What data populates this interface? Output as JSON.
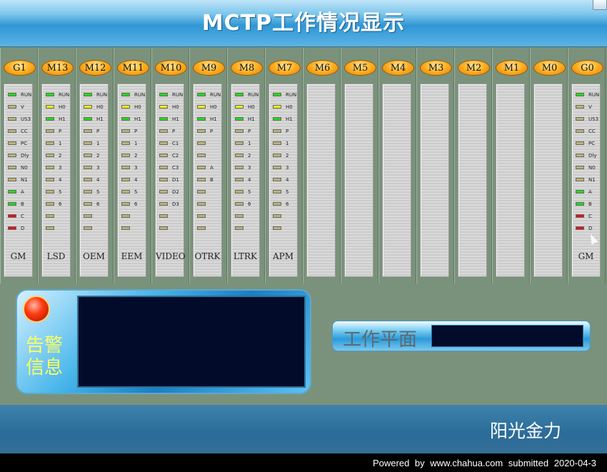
{
  "app": {
    "title": "MCTP工作情况显示"
  },
  "colors": {
    "led_green": "#22d82a",
    "led_yellow": "#f2ef1e",
    "led_red": "#e0102e",
    "led_off": "#b7b28a",
    "title_blue": "#2f96d4",
    "strip_bg": "#7a927b"
  },
  "modules": [
    {
      "id": "G1",
      "name": "GM",
      "leds": [
        {
          "s": "green",
          "t": "RUN"
        },
        {
          "s": "off",
          "t": "V"
        },
        {
          "s": "off",
          "t": "US3"
        },
        {
          "s": "off",
          "t": "CC"
        },
        {
          "s": "off",
          "t": "PC"
        },
        {
          "s": "off",
          "t": "Dly"
        },
        {
          "s": "off",
          "t": "N0"
        },
        {
          "s": "off",
          "t": "N1"
        },
        {
          "s": "green",
          "t": "A"
        },
        {
          "s": "green",
          "t": "B"
        },
        {
          "s": "red",
          "t": "C"
        },
        {
          "s": "red",
          "t": "D"
        }
      ]
    },
    {
      "id": "M13",
      "name": "LSD",
      "leds": [
        {
          "s": "green",
          "t": "RUN"
        },
        {
          "s": "yellow",
          "t": "H0"
        },
        {
          "s": "green",
          "t": "H1"
        },
        {
          "s": "off",
          "t": "P"
        },
        {
          "s": "off",
          "t": "1"
        },
        {
          "s": "off",
          "t": "2"
        },
        {
          "s": "off",
          "t": "3"
        },
        {
          "s": "off",
          "t": "4"
        },
        {
          "s": "off",
          "t": "5"
        },
        {
          "s": "off",
          "t": "6"
        },
        {
          "s": "off",
          "t": ""
        },
        {
          "s": "off",
          "t": ""
        }
      ]
    },
    {
      "id": "M12",
      "name": "OEM",
      "leds": [
        {
          "s": "green",
          "t": "RUN"
        },
        {
          "s": "yellow",
          "t": "H0"
        },
        {
          "s": "green",
          "t": "H1"
        },
        {
          "s": "off",
          "t": "P"
        },
        {
          "s": "off",
          "t": "1"
        },
        {
          "s": "off",
          "t": "2"
        },
        {
          "s": "off",
          "t": "3"
        },
        {
          "s": "off",
          "t": "4"
        },
        {
          "s": "off",
          "t": "5"
        },
        {
          "s": "off",
          "t": "6"
        },
        {
          "s": "off",
          "t": ""
        },
        {
          "s": "off",
          "t": ""
        }
      ]
    },
    {
      "id": "M11",
      "name": "EEM",
      "leds": [
        {
          "s": "green",
          "t": "RUN"
        },
        {
          "s": "yellow",
          "t": "H0"
        },
        {
          "s": "green",
          "t": "H1"
        },
        {
          "s": "off",
          "t": "P"
        },
        {
          "s": "off",
          "t": "1"
        },
        {
          "s": "off",
          "t": "2"
        },
        {
          "s": "off",
          "t": "3"
        },
        {
          "s": "off",
          "t": "4"
        },
        {
          "s": "off",
          "t": "5"
        },
        {
          "s": "off",
          "t": "6"
        },
        {
          "s": "off",
          "t": ""
        },
        {
          "s": "off",
          "t": ""
        }
      ]
    },
    {
      "id": "M10",
      "name": "VIDEO",
      "leds": [
        {
          "s": "green",
          "t": "RUN"
        },
        {
          "s": "yellow",
          "t": "H0"
        },
        {
          "s": "green",
          "t": "H1"
        },
        {
          "s": "off",
          "t": "P"
        },
        {
          "s": "off",
          "t": "C1"
        },
        {
          "s": "off",
          "t": "C2"
        },
        {
          "s": "off",
          "t": "C3"
        },
        {
          "s": "off",
          "t": "D1"
        },
        {
          "s": "off",
          "t": "D2"
        },
        {
          "s": "off",
          "t": "D3"
        },
        {
          "s": "off",
          "t": ""
        },
        {
          "s": "off",
          "t": ""
        }
      ]
    },
    {
      "id": "M9",
      "name": "OTRK",
      "leds": [
        {
          "s": "green",
          "t": "RUN"
        },
        {
          "s": "yellow",
          "t": "H0"
        },
        {
          "s": "green",
          "t": "H1"
        },
        {
          "s": "off",
          "t": "P"
        },
        {
          "s": "off",
          "t": ""
        },
        {
          "s": "off",
          "t": ""
        },
        {
          "s": "off",
          "t": "A"
        },
        {
          "s": "off",
          "t": "B"
        },
        {
          "s": "off",
          "t": ""
        },
        {
          "s": "off",
          "t": ""
        },
        {
          "s": "off",
          "t": ""
        },
        {
          "s": "off",
          "t": ""
        }
      ]
    },
    {
      "id": "M8",
      "name": "LTRK",
      "leds": [
        {
          "s": "green",
          "t": "RUN"
        },
        {
          "s": "yellow",
          "t": "H0"
        },
        {
          "s": "green",
          "t": "H1"
        },
        {
          "s": "off",
          "t": "P"
        },
        {
          "s": "off",
          "t": "1"
        },
        {
          "s": "off",
          "t": "2"
        },
        {
          "s": "off",
          "t": "3"
        },
        {
          "s": "off",
          "t": "4"
        },
        {
          "s": "off",
          "t": "5"
        },
        {
          "s": "off",
          "t": "6"
        },
        {
          "s": "off",
          "t": ""
        },
        {
          "s": "off",
          "t": ""
        }
      ]
    },
    {
      "id": "M7",
      "name": "APM",
      "leds": [
        {
          "s": "green",
          "t": "RUN"
        },
        {
          "s": "yellow",
          "t": "H0"
        },
        {
          "s": "green",
          "t": "H1"
        },
        {
          "s": "off",
          "t": "P"
        },
        {
          "s": "off",
          "t": "1"
        },
        {
          "s": "off",
          "t": "2"
        },
        {
          "s": "off",
          "t": "3"
        },
        {
          "s": "off",
          "t": "4"
        },
        {
          "s": "off",
          "t": "5"
        },
        {
          "s": "off",
          "t": "6"
        },
        {
          "s": "off",
          "t": ""
        },
        {
          "s": "off",
          "t": ""
        }
      ]
    },
    {
      "id": "M6",
      "name": "",
      "leds": []
    },
    {
      "id": "M5",
      "name": "",
      "leds": []
    },
    {
      "id": "M4",
      "name": "",
      "leds": []
    },
    {
      "id": "M3",
      "name": "",
      "leds": []
    },
    {
      "id": "M2",
      "name": "",
      "leds": []
    },
    {
      "id": "M1",
      "name": "",
      "leds": []
    },
    {
      "id": "M0",
      "name": "",
      "leds": []
    },
    {
      "id": "G0",
      "name": "GM",
      "leds": [
        {
          "s": "green",
          "t": "RUN"
        },
        {
          "s": "off",
          "t": "V"
        },
        {
          "s": "off",
          "t": "US3"
        },
        {
          "s": "off",
          "t": "CC"
        },
        {
          "s": "off",
          "t": "PC"
        },
        {
          "s": "off",
          "t": "Dly"
        },
        {
          "s": "off",
          "t": "N0"
        },
        {
          "s": "off",
          "t": "N1"
        },
        {
          "s": "green",
          "t": "A"
        },
        {
          "s": "green",
          "t": "B"
        },
        {
          "s": "red",
          "t": "C"
        },
        {
          "s": "red",
          "t": "D"
        }
      ]
    }
  ],
  "alarm": {
    "label": "告警信息",
    "message": ""
  },
  "work_plane": {
    "label": "工作平面",
    "value": ""
  },
  "footer": {
    "brand": "阳光金力",
    "powered": "Powered by www.chahua.com submitted 2020-04-3"
  }
}
